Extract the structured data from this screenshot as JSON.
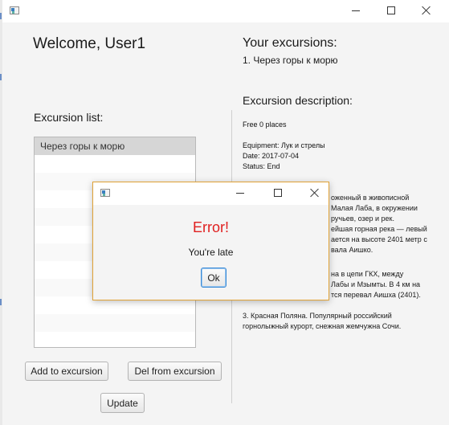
{
  "window": {
    "minimize_label": "Minimize",
    "maximize_label": "Maximize",
    "close_label": "Close"
  },
  "header": {
    "welcome": "Welcome, User1"
  },
  "my_excursions": {
    "title": "Your excursions:",
    "items": [
      "1. Через горы к морю"
    ]
  },
  "excursion_list": {
    "title": "Excursion list:",
    "items": [
      "Через горы к морю"
    ]
  },
  "buttons": {
    "add": "Add to excursion",
    "del": "Del from excursion",
    "update": "Update"
  },
  "description": {
    "title": "Excursion description:",
    "places": "Free 0 places",
    "equipment": "Equipment: Лук и стрелы",
    "date": "Date: 2017-07-04",
    "status": "Status: End",
    "para1_lines": [
      "оженный в живописной",
      "Малая Лаба, в окружении",
      "ручьев, озер и рек.",
      "ейшая горная река — левый",
      "ается на высоте 2401 метр с",
      "вала Аишко."
    ],
    "para2_lines": [
      "на в цепи ГКХ, между",
      "Лабы и Мзымты. В 4 км на",
      "тся перевал Аишха (2401)."
    ],
    "para3_lines": [
      "3. Красная Поляна. Популярный российский",
      "горнолыжный курорт, снежная жемчужна Сочи."
    ]
  },
  "dialog": {
    "title_text": "",
    "error_title": "Error!",
    "message": "You're late",
    "ok_label": "Ok"
  },
  "colors": {
    "error": "#e02020",
    "dialog_border": "#e0a236",
    "selected_row": "#d6d6d6"
  }
}
